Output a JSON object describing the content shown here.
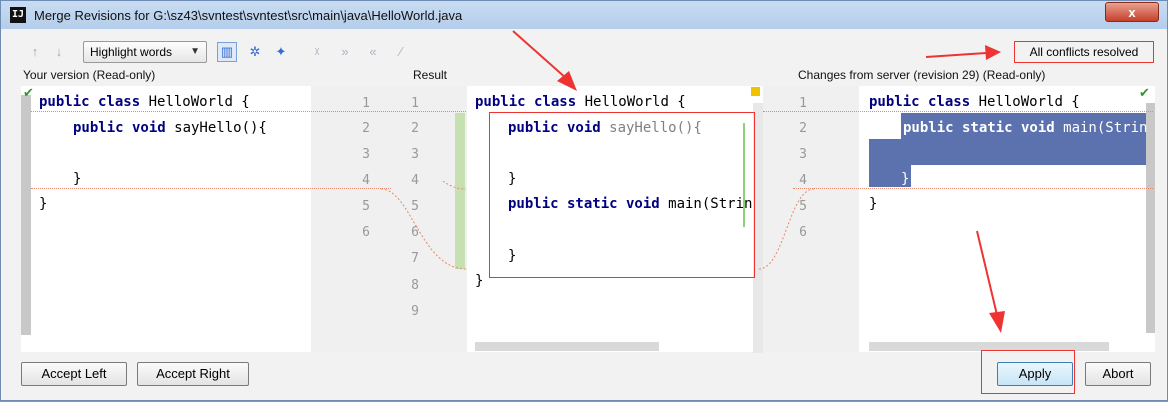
{
  "window": {
    "title": "Merge Revisions for G:\\sz43\\svntest\\svntest\\src\\main\\java\\HelloWorld.java",
    "app_icon": "IJ",
    "close_glyph": "x"
  },
  "toolbar": {
    "highlight_label": "Highlight words",
    "status": "All conflicts resolved"
  },
  "panes": {
    "left_title": "Your version (Read-only)",
    "center_title": "Result",
    "right_title": "Changes from server (revision 29) (Read-only)"
  },
  "code": {
    "l1_kw": "public class",
    "l1_rest": " HelloWorld {",
    "l2_kw": "public void",
    "l2_rest": " sayHello(){",
    "l4": "}",
    "l5": "}",
    "c2_kw": "public void",
    "c2_rest": " sayHello(){",
    "c4": "}",
    "c5_kw": "public static void",
    "c5_rest": " main(Strin",
    "c7": "}",
    "c8": "}",
    "r2_kw": "public static void",
    "r2_rest": " main(Strin",
    "r4": "}",
    "r5": "}"
  },
  "line_numbers": {
    "left_gutter": [
      "1",
      "2",
      "3",
      "4",
      "5",
      "6"
    ],
    "center_gutter": [
      "1",
      "2",
      "3",
      "4",
      "5",
      "6",
      "7",
      "8",
      "9"
    ],
    "right_gutter": [
      "1",
      "2",
      "3",
      "4",
      "5",
      "6"
    ]
  },
  "buttons": {
    "accept_left": "Accept Left",
    "accept_right": "Accept Right",
    "apply": "Apply",
    "abort": "Abort"
  },
  "colors": {
    "keyword": "#000080",
    "selection": "#5b72ae",
    "annotation_red": "#ee3333",
    "changed_green": "#c6e0b0"
  }
}
